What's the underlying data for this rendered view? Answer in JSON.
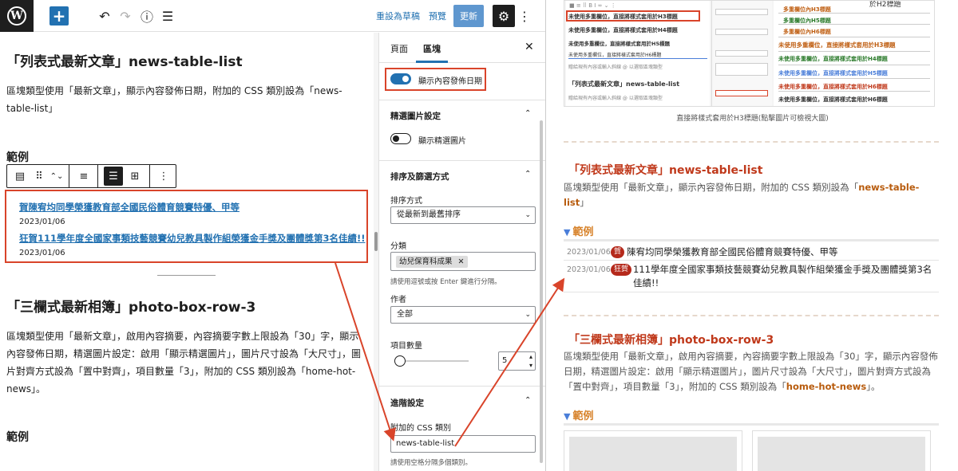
{
  "toolbar": {
    "wp_logo": "W",
    "add_icon": "+",
    "undo_icon": "↶",
    "redo_icon": "↷",
    "info_icon": "ⓘ",
    "list_icon": "☰",
    "save_draft": "重設為草稿",
    "preview": "預覽",
    "update": "更新",
    "settings_icon": "⚙",
    "more_icon": "⋮"
  },
  "content": {
    "heading1": "「列表式最新文章」news-table-list",
    "para1": "區塊類型使用「最新文章」，顯示內容發佈日期，附加的 CSS 類別設為「news-table-list」",
    "example1": "範例",
    "block_toolbar": {
      "icons": [
        "▤",
        "⠿",
        "⌃⌄",
        "≡",
        "☰",
        "⊞",
        "⋮"
      ]
    },
    "latest_posts": [
      {
        "title": "賀陳宥均同學榮獲教育部全國民俗體育競賽特優、甲等",
        "date": "2023/01/06"
      },
      {
        "title": "狂賀111學年度全國家事類技藝競賽幼兒教具製作組榮獲金手獎及團體獎第3名佳績!!",
        "date": "2023/01/06"
      }
    ],
    "heading2": "「三欄式最新相簿」photo-box-row-3",
    "para2": "區塊類型使用「最新文章」，啟用內容摘要，內容摘要字數上限設為「30」字，顯示內容發佈日期，精選圖片設定：啟用「顯示精選圖片」，圖片尺寸設為「大尺寸」，圖片對齊方式設為「置中對齊」，項目數量「3」，附加的 CSS 類別設為「home-hot-news」。",
    "example2": "範例"
  },
  "sidebar": {
    "tab_page": "頁面",
    "tab_block": "區塊",
    "close_icon": "✕",
    "show_date_label": "顯示內容發佈日期",
    "show_date_on": true,
    "featured_section": "精選圖片設定",
    "show_featured_label": "顯示精選圖片",
    "show_featured_on": false,
    "sort_section": "排序及篩選方式",
    "sort_label": "排序方式",
    "sort_value": "從最新到最舊排序",
    "category_label": "分類",
    "category_token": "幼兒保育科成果",
    "token_remove_icon": "✕",
    "category_help": "請使用逗號或按 Enter 鍵進行分隔。",
    "author_label": "作者",
    "author_value": "全部",
    "count_label": "項目數量",
    "count_value": "5",
    "count_fraction": 0.05,
    "advanced_section": "進階設定",
    "css_label": "附加的 CSS 類別",
    "css_value": "news-table-list",
    "css_help": "請使用空格分隔多個類別。",
    "chevron_up_icon": "⌃"
  },
  "preview": {
    "shot": {
      "top_label": "於H2標題",
      "row1": "未使用多重欄位，直接將樣式套用於H3標題",
      "row2": "未使用多重欄位，直接將樣式套用於H4標題",
      "row3": "未使用多重欄位，直接將樣式套用於H5標題",
      "row4": "未使用多重欄位，直接將樣式套用於H6標題",
      "heading": "「列表式最新文章」news-table-list",
      "subline": "贈給現有內容或輸入斜線 @ 以選取區塊類型",
      "item_a": "多重欄位內H3標題",
      "item_b": "多重欄位內H5標題",
      "item_c": "多重欄位內H6標題",
      "item_d": "未使用多重欄位，直接將樣式套用於H3標題",
      "item_e": "未使用多重欄位，直接將樣式套用於H4標題",
      "item_f": "未使用多重欄位，直接將樣式套用於H5標題",
      "item_g": "未使用多重欄位，直接將樣式套用於H6標題"
    },
    "caption": "直接將樣式套用於H3標題(點擊圖片可檢視大圖)",
    "heading1": "「列表式最新文章」news-table-list",
    "para1_prefix": "區塊類型使用「最新文章」，顯示內容發佈日期，附加的 CSS 類別設為「",
    "para1_hl": "news-table-list",
    "para1_suffix": "」",
    "example1": "範例",
    "example_tri": "▼",
    "news": [
      {
        "date": "2023/01/06",
        "badge": "賀",
        "title": "陳宥均同學榮獲教育部全國民俗體育競賽特優、甲等"
      },
      {
        "date": "2023/01/06",
        "badge": "狂賀",
        "title": "111學年度全國家事類技藝競賽幼兒教具製作組榮獲金手獎及團體獎第3名佳績!!"
      }
    ],
    "heading2": "「三欄式最新相簿」photo-box-row-3",
    "para2_prefix": "區塊類型使用「最新文章」，啟用內容摘要，內容摘要字數上限設為「30」字，顯示內容發佈日期，精選圖片設定：啟用「顯示精選圖片」，圖片尺寸設為「大尺寸」，圖片對齊方式設為「置中對齊」，項目數量「3」，附加的 CSS 類別設為「",
    "para2_hl": "home-hot-news",
    "para2_suffix": "」。",
    "example2": "範例"
  },
  "colors": {
    "annotation": "#d9442a",
    "wp_blue": "#2271b1",
    "heading_red": "#c0391b",
    "example_orange": "#d7822a"
  }
}
